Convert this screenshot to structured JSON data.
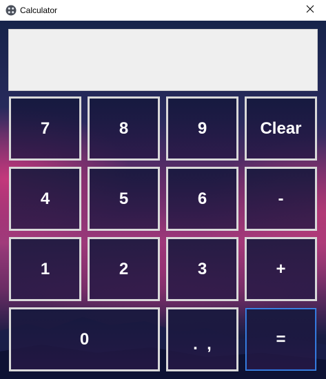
{
  "window": {
    "title": "Calculator",
    "icon": "calculator-app-icon",
    "close_icon": "close-icon"
  },
  "display": {
    "value": ""
  },
  "keys": {
    "seven": "7",
    "eight": "8",
    "nine": "9",
    "clear": "Clear",
    "four": "4",
    "five": "5",
    "six": "6",
    "minus": "-",
    "one": "1",
    "two": "2",
    "three": "3",
    "plus": "+",
    "zero": "0",
    "decimal": ".  ,",
    "equals": "="
  },
  "colors": {
    "key_border": "#d9d9d9",
    "focus_border": "#3f8ef0",
    "display_bg": "#efefef"
  }
}
